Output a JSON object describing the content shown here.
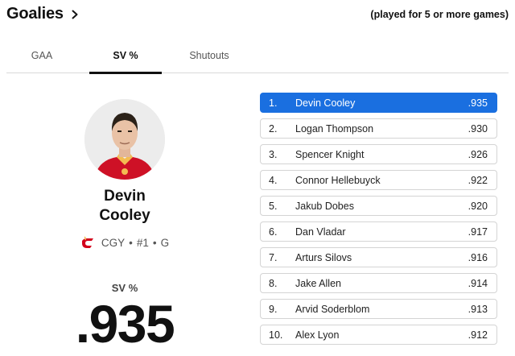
{
  "header": {
    "title": "Goalies",
    "note": "(played for 5 or more games)"
  },
  "tabs": [
    {
      "label": "GAA",
      "active": false
    },
    {
      "label": "SV %",
      "active": true
    },
    {
      "label": "Shutouts",
      "active": false
    }
  ],
  "featured": {
    "first_name": "Devin",
    "last_name": "Cooley",
    "team": "CGY",
    "number": "#1",
    "position": "G",
    "separator": "•",
    "stat_label": "SV %",
    "stat_value": ".935"
  },
  "leaders": [
    {
      "rank": "1.",
      "name": "Devin Cooley",
      "value": ".935",
      "active": true
    },
    {
      "rank": "2.",
      "name": "Logan Thompson",
      "value": ".930",
      "active": false
    },
    {
      "rank": "3.",
      "name": "Spencer Knight",
      "value": ".926",
      "active": false
    },
    {
      "rank": "4.",
      "name": "Connor Hellebuyck",
      "value": ".922",
      "active": false
    },
    {
      "rank": "5.",
      "name": "Jakub Dobes",
      "value": ".920",
      "active": false
    },
    {
      "rank": "6.",
      "name": "Dan Vladar",
      "value": ".917",
      "active": false
    },
    {
      "rank": "7.",
      "name": "Arturs Silovs",
      "value": ".916",
      "active": false
    },
    {
      "rank": "8.",
      "name": "Jake Allen",
      "value": ".914",
      "active": false
    },
    {
      "rank": "9.",
      "name": "Arvid Soderblom",
      "value": ".913",
      "active": false
    },
    {
      "rank": "10.",
      "name": "Alex Lyon",
      "value": ".912",
      "active": false
    }
  ],
  "colors": {
    "accent": "#1a6fe0",
    "team": "#d2001c"
  },
  "icons": {
    "header": "chevron-right-icon",
    "team": "calgary-flames-logo"
  }
}
